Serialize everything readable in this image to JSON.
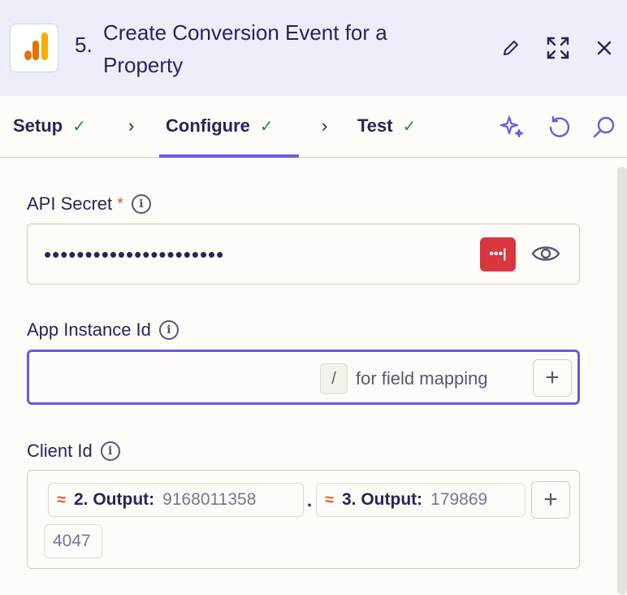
{
  "header": {
    "step_number": "5.",
    "title": "Create Conversion Event for a Property",
    "app_colors": [
      "#f9ab00",
      "#e37400"
    ],
    "icons": [
      "pencil-icon",
      "expand-icon",
      "close-icon"
    ]
  },
  "tabs": {
    "items": [
      {
        "label": "Setup",
        "complete": true
      },
      {
        "label": "Configure",
        "complete": true,
        "active": true
      },
      {
        "label": "Test",
        "complete": true
      }
    ],
    "check_glyph": "✓",
    "separator_glyph": "›",
    "right_icons": [
      "ai-sparkle-icon",
      "refresh-icon",
      "search-icon"
    ]
  },
  "fields": {
    "api_secret": {
      "label": "API Secret",
      "required_mark": "*",
      "value_masked": "••••••••••••••••••••••",
      "password_manager_glyph": "•••|"
    },
    "app_instance": {
      "label": "App Instance Id",
      "slash_key": "/",
      "hint": "for field mapping",
      "plus": "+"
    },
    "client_id": {
      "label": "Client Id",
      "pills": [
        {
          "label": "2. Output:",
          "value": "9168011358"
        },
        {
          "label": "3. Output:",
          "value": "179869"
        }
      ],
      "separator": ".",
      "wrapped_value": "4047",
      "plus": "+"
    }
  },
  "colors": {
    "accent": "#6a5ae0",
    "success": "#1f8f4e",
    "required": "#e4572e",
    "header_bg": "#eceef9"
  }
}
